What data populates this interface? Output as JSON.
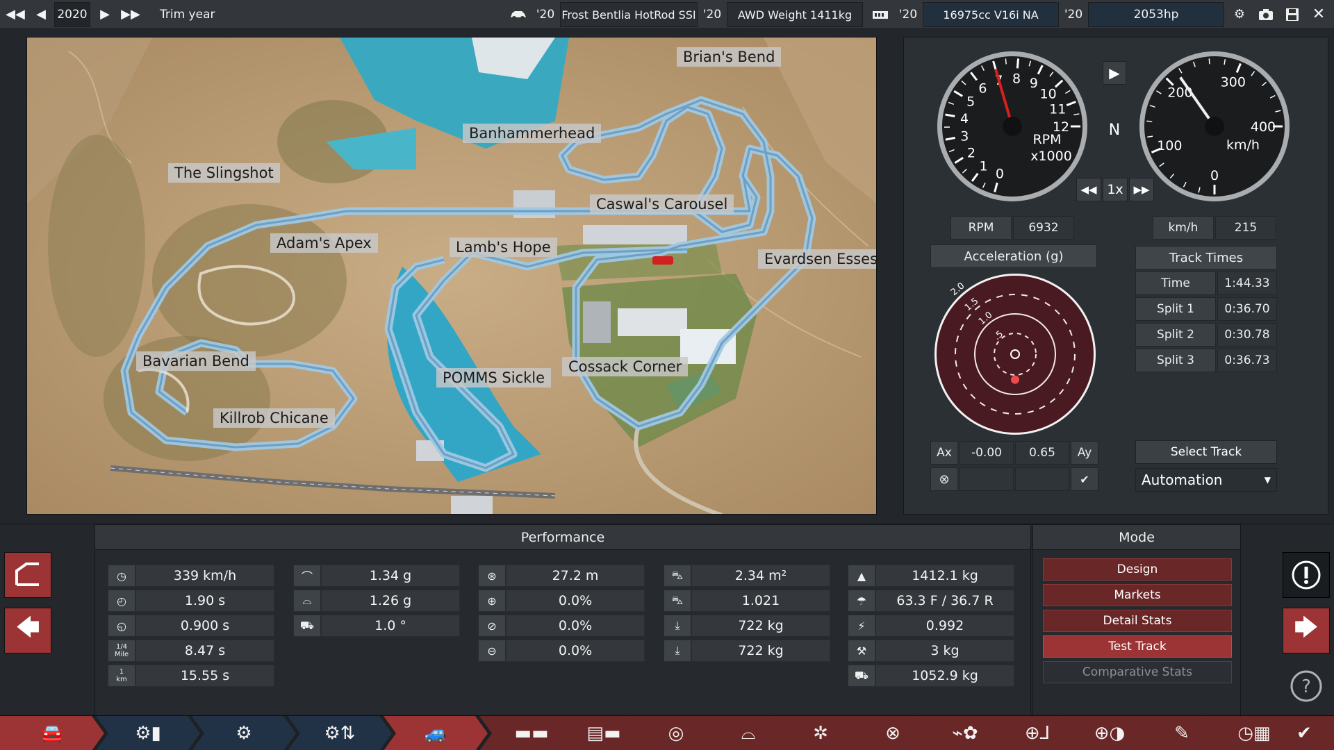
{
  "topbar": {
    "year": "2020",
    "trim_label": "Trim year",
    "model_year": "'20",
    "model_name": "Frost Bentlia HotRod SSI",
    "trim_year": "'20",
    "drivetrain_weight": "AWD Weight 1411kg",
    "engine_year": "'20",
    "engine": "16975cc V16i NA",
    "power_year": "'20",
    "power": "2053hp"
  },
  "map": {
    "labels": [
      "Brian's Bend",
      "Banhammerhead",
      "The Slingshot",
      "Caswal's Carousel",
      "Adam's Apex",
      "Lamb's Hope",
      "Evardsen Esses",
      "Bavarian Bend",
      "POMMS Sickle",
      "Cossack Corner",
      "Killrob Chicane"
    ]
  },
  "gauges": {
    "rpm_ticks": [
      "0",
      "1",
      "2",
      "3",
      "4",
      "5",
      "6",
      "7",
      "8",
      "9",
      "10",
      "11",
      "12"
    ],
    "rpm_unit": "RPM",
    "rpm_mult": "x1000",
    "rpm_needle": 7.0,
    "speed_ticks": [
      "0",
      "100",
      "200",
      "300",
      "400"
    ],
    "speed_unit": "km/h",
    "speed_needle": 215,
    "gear": "N",
    "playback_speed": "1x"
  },
  "readouts": {
    "rpm_label": "RPM",
    "rpm_value": "6932",
    "speed_label": "km/h",
    "speed_value": "215"
  },
  "accel": {
    "title": "Acceleration (g)",
    "ring_labels": [
      "2.0",
      "1.5",
      "1.0",
      ".5"
    ],
    "ax_label": "Ax",
    "ax_value": "-0.00",
    "ay_value": "0.65",
    "ay_label": "Ay",
    "dot_x": 0.0,
    "dot_y": 0.65
  },
  "track_times": {
    "title": "Track Times",
    "rows": [
      {
        "label": "Time",
        "value": "1:44.33"
      },
      {
        "label": "Split 1",
        "value": "0:36.70"
      },
      {
        "label": "Split 2",
        "value": "0:30.78"
      },
      {
        "label": "Split 3",
        "value": "0:36.73"
      }
    ],
    "select_label": "Select Track",
    "track_name": "Automation"
  },
  "performance": {
    "title": "Performance",
    "col1": [
      {
        "icon": "top-speed-icon",
        "value": "339 km/h"
      },
      {
        "icon": "accel-60-icon",
        "value": "1.90 s"
      },
      {
        "icon": "accel-100-icon",
        "value": "0.900 s"
      },
      {
        "icon": "quarter-mile-icon",
        "label": "1/4\nMile",
        "value": "8.47 s"
      },
      {
        "icon": "one-km-icon",
        "label": "1\nkm",
        "value": "15.55 s"
      }
    ],
    "col2": [
      {
        "icon": "lateral-g-icon",
        "value": "1.34 g"
      },
      {
        "icon": "lateral-g-low-icon",
        "value": "1.26 g"
      },
      {
        "icon": "body-roll-icon",
        "value": "1.0 °"
      }
    ],
    "col3": [
      {
        "icon": "braking-distance-icon",
        "value": "27.2 m"
      },
      {
        "icon": "brake-fade-icon",
        "value": "0.0%"
      },
      {
        "icon": "brake-fade-2-icon",
        "value": "0.0%"
      },
      {
        "icon": "brake-fade-3-icon",
        "value": "0.0%"
      }
    ],
    "col4": [
      {
        "icon": "frontal-area-icon",
        "value": "2.34 m²"
      },
      {
        "icon": "drag-coefficient-icon",
        "value": "1.021"
      },
      {
        "icon": "front-downforce-icon",
        "value": "722 kg"
      },
      {
        "icon": "rear-downforce-icon",
        "value": "722 kg"
      }
    ],
    "col5": [
      {
        "icon": "weight-icon",
        "value": "1412.1 kg"
      },
      {
        "icon": "weight-distribution-icon",
        "value": "63.3 F / 36.7 R"
      },
      {
        "icon": "balance-icon",
        "value": "0.992"
      },
      {
        "icon": "tools-weight-icon",
        "value": "3 kg"
      },
      {
        "icon": "tow-weight-icon",
        "value": "1052.9 kg"
      }
    ]
  },
  "mode": {
    "title": "Mode",
    "items": [
      {
        "label": "Design",
        "state": "normal"
      },
      {
        "label": "Markets",
        "state": "normal"
      },
      {
        "label": "Detail Stats",
        "state": "normal"
      },
      {
        "label": "Test Track",
        "state": "active"
      },
      {
        "label": "Comparative Stats",
        "state": "disabled"
      }
    ]
  },
  "colors": {
    "accent_red": "#9c3334",
    "dark_red": "#6a2727",
    "track_blue": "#8fbfe0"
  }
}
